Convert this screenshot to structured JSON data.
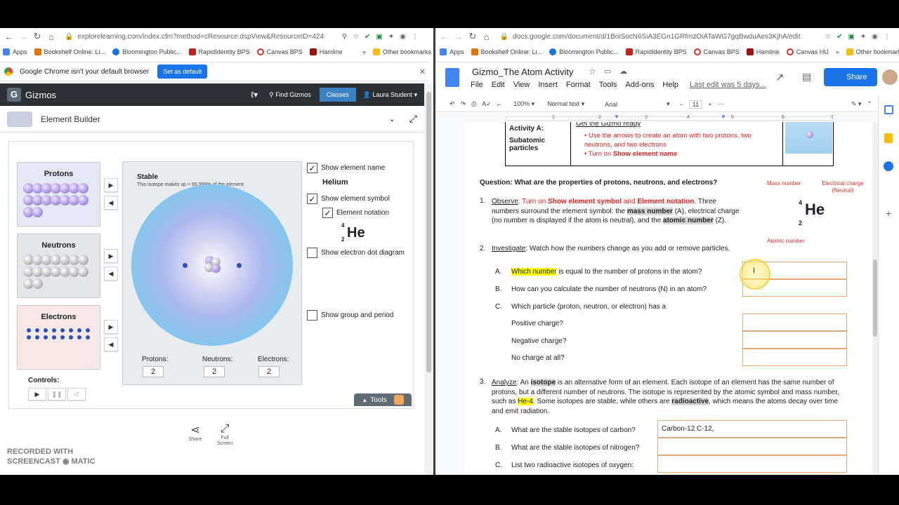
{
  "left_browser": {
    "url": "explorelearning.com/index.cfm?method=cResource.dspView&ResourceID=424",
    "bookmarks": [
      "Apps",
      "Bookshelf Online: Li...",
      "Bloomington Public...",
      "RapidIdentity BPS",
      "Canvas BPS",
      "Hamline"
    ],
    "other_bookmarks": "Other bookmarks",
    "more": "»",
    "infobar": {
      "text": "Google Chrome isn't your default browser",
      "button": "Set as default",
      "close": "✕"
    }
  },
  "gizmo": {
    "brand": "Gizmos",
    "find": "Find Gizmos",
    "classes": "Classes",
    "user": "Laura Student ▾",
    "title": "Element Builder",
    "particles": {
      "protons": "Protons",
      "neutrons": "Neutrons",
      "electrons": "Electrons"
    },
    "atom": {
      "status": "Stable",
      "note": "This isotope makes up > 99.999% of the element"
    },
    "counts": {
      "protons_label": "Protons:",
      "protons": "2",
      "neutrons_label": "Neutrons:",
      "neutrons": "2",
      "electrons_label": "Electrons:",
      "electrons": "2"
    },
    "options": {
      "show_name": "Show element name",
      "element_name": "Helium",
      "show_symbol": "Show element symbol",
      "notation": "Element notation",
      "mass": "4",
      "atomic": "2",
      "symbol": "He",
      "dot_diagram": "Show electron dot diagram",
      "group_period": "Show group and period"
    },
    "controls": "Controls:",
    "tools": "Tools",
    "share": "Share",
    "fullscreen": "Full Screen",
    "watermark": "RECORDED WITH SCREENCAST ◉ MATIC"
  },
  "right_browser": {
    "url": "docs.google.com/document/d/1BoiSocN6SiA3EGn1GRfmzOiATaWG7gqBwduAes3KjhA/edit",
    "bookmarks": [
      "Apps",
      "Bookshelf Online: Li...",
      "Bloomington Public...",
      "RapidIdentity BPS",
      "Canvas BPS",
      "Hamline",
      "Canvas HU"
    ],
    "other_bookmarks": "Other bookmarks",
    "more": "»"
  },
  "docs": {
    "title": "Gizmo_The Atom Activity",
    "menu": [
      "File",
      "Edit",
      "View",
      "Insert",
      "Format",
      "Tools",
      "Add-ons",
      "Help"
    ],
    "last_edit": "Last edit was 5 days...",
    "share": "Share",
    "toolbar": {
      "zoom": "100%",
      "style": "Normal text",
      "font": "Arial",
      "size": "11"
    },
    "ruler": [
      "1",
      "2",
      "3",
      "4",
      "5",
      "6",
      "7"
    ],
    "activity": {
      "a": "Activity A:",
      "sub": "Subatomic particles",
      "header": "Get the Gizmo ready",
      "bullet1": "Use the arrows to create an atom with two protons, two neutrons, and two electrons",
      "bullet2_pre": "Turn on ",
      "bullet2_bold": "Show element name"
    },
    "question": "Question: What are the properties of protons, neutrons, and electrons?",
    "diagram": {
      "mass_label": "Mass number",
      "charge_label": "Electrical charge (Neutral)",
      "atomic_label": "Atomic number",
      "mass": "4",
      "atomic": "2",
      "symbol": "He"
    },
    "q1": {
      "num": "1.",
      "lead": "Observe",
      "p1": ": Turn on ",
      "b1": "Show element symbol",
      "p2": " and ",
      "b2": "Element notation",
      "p3": ". Three numbers surround the element symbol: the ",
      "mass": "mass number",
      "p4": " (A), electrical charge (no number is displayed if the atom is neutral), and the ",
      "atomic": "atomic number",
      "p5": " (Z)."
    },
    "q2": {
      "num": "2.",
      "lead": "Investigate",
      "text": ": Watch how the numbers change as you add or remove particles.",
      "a_letter": "A.",
      "a_hl": "Which number",
      "a_rest": " is equal to the number of protons in the atom?",
      "b_letter": "B.",
      "b_text": "How can you calculate the number of neutrons (N) in an atom?",
      "c_letter": "C.",
      "c_text": "Which particle (proton, neutron, or electron) has a",
      "pos": "Positive charge?",
      "neg": "Negative charge?",
      "none": "No charge at all?"
    },
    "q3": {
      "num": "3.",
      "lead": "Analyze",
      "p1": ": An ",
      "iso": "isotope",
      "p2": " is an alternative form of an element. Each isotope of an element has the same number of protons, but a different number of neutrons. The isotope is represented by the atomic symbol and mass number, such as ",
      "he4": "He-4",
      "p3": ". Some isotopes are stable, while others are ",
      "radio": "radioactive",
      "p4": ", which means the atoms decay over time and emit radiation.",
      "a_letter": "A.",
      "a_text": "What are the stable isotopes of carbon?",
      "a_answer": "Carbon-12 C-12,",
      "b_letter": "B.",
      "b_text": "What are the stable isotopes of nitrogen?",
      "c_letter": "C.",
      "c_text": "List two radioactive isotopes of oxygen:"
    }
  }
}
